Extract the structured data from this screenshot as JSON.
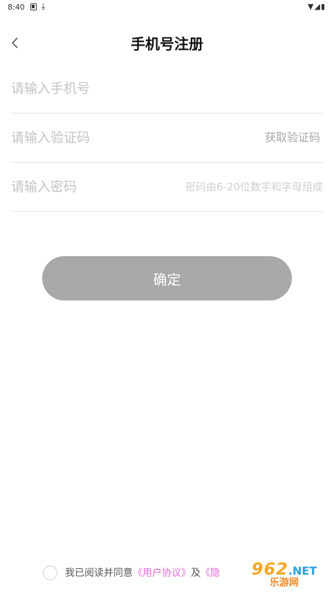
{
  "status_bar": {
    "time": "8:40",
    "icons": [
      "notification-icon",
      "download-icon",
      "wifi-icon",
      "signal-icon",
      "battery-icon"
    ]
  },
  "header": {
    "title": "手机号注册",
    "back_icon": "chevron-left-icon"
  },
  "form": {
    "phone": {
      "placeholder": "请输入手机号",
      "value": ""
    },
    "code": {
      "placeholder": "请输入验证码",
      "value": "",
      "action_label": "获取验证码"
    },
    "password": {
      "placeholder": "请输入密码",
      "value": "",
      "hint": "密码由6-20位数字和字母组成"
    }
  },
  "confirm_button": {
    "label": "确定",
    "color": "#a8a8a8"
  },
  "agreement": {
    "prefix": "我已阅读并同意",
    "user_agreement": "《用户协议》",
    "conjunction": "及",
    "privacy_partial": "《隐",
    "link_color": "#e06ad6"
  },
  "watermark": {
    "number": "962",
    "domain": ".NET",
    "subtitle": "乐游网"
  }
}
